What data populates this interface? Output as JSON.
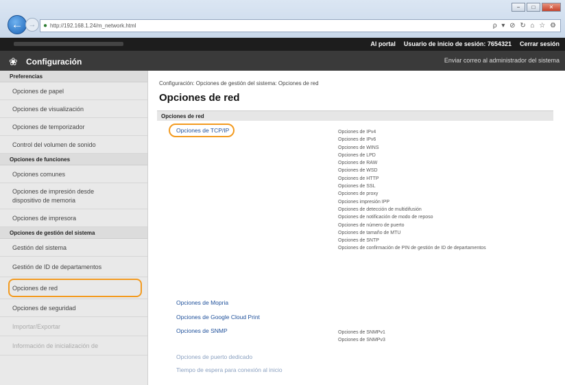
{
  "browser": {
    "url": "http://192.168.1.24/m_network.html",
    "tools": "ρ ▾ ⊘ ↻  ⌂ ☆ ⚙",
    "window_buttons": [
      "−",
      "□",
      "✕"
    ]
  },
  "header": {
    "portal": "Al portal",
    "login_user": "Usuario de inicio de sesión:  7654321",
    "logout": "Cerrar sesión",
    "app_title": "Configuración",
    "mail_admin": "Enviar correo al administrador del sistema"
  },
  "sidebar": {
    "sections": [
      {
        "title": "Preferencias",
        "items": [
          "Opciones de papel",
          "Opciones de visualización",
          "Opciones de temporizador",
          "Control del volumen de sonido"
        ]
      },
      {
        "title": "Opciones de funciones",
        "items": [
          "Opciones comunes",
          "Opciones de impresión desde dispositivo de memoria",
          "Opciones de impresora"
        ]
      },
      {
        "title": "Opciones de gestión del sistema",
        "items": [
          "Gestión del sistema",
          "Gestión de ID de departamentos",
          "Opciones de red",
          "Opciones de seguridad",
          "Importar/Exportar",
          "Información de inicialización de"
        ]
      }
    ]
  },
  "main": {
    "breadcrumb": "Configuración: Opciones de gestión del sistema: Opciones de red",
    "title": "Opciones de red",
    "section_header": "Opciones de red",
    "tcpip": {
      "label": "Opciones de TCP/IP",
      "details": [
        "Opciones de IPv4",
        "Opciones de IPv6",
        "Opciones de WINS",
        "Opciones de LPD",
        "Opciones de RAW",
        "Opciones de WSD",
        "Opciones de HTTP",
        "Opciones de SSL",
        "Opciones de proxy",
        "Opciones impresión IPP",
        "Opciones de detección de multidifusión",
        "Opciones de notificación de modo de reposo",
        "Opciones de número de puerto",
        "Opciones de tamaño de MTU",
        "Opciones de SNTP",
        "Opciones de confirmación de PIN de gestión de ID de departamentos"
      ]
    },
    "mopria": "Opciones de Mopria",
    "gcp": "Opciones de Google Cloud Print",
    "snmp": {
      "label": "Opciones de SNMP",
      "details": [
        "Opciones de SNMPv1",
        "Opciones de SNMPv3"
      ]
    },
    "dedicated_port": "Opciones de puerto dedicado",
    "wait_time": "Tiempo de espera para conexión al inicio"
  }
}
